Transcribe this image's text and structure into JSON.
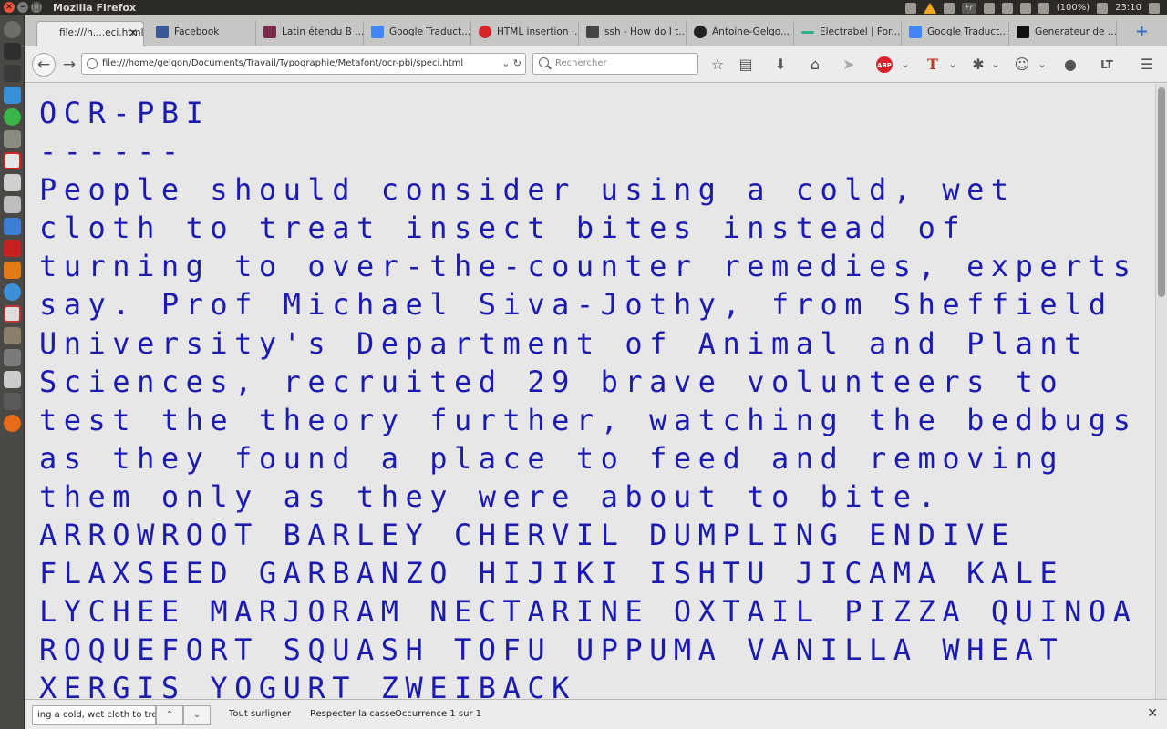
{
  "system": {
    "app_title": "Mozilla Firefox",
    "battery": "(100%)",
    "time": "23:10",
    "keyboard_layout": "Fr"
  },
  "tabs": [
    {
      "label": "file:///h....eci.html",
      "active": true,
      "icon": "file-icon"
    },
    {
      "label": "Facebook",
      "icon": "facebook-icon"
    },
    {
      "label": "Latin étendu B ...",
      "icon": "unicode-icon"
    },
    {
      "label": "Google Traduct...",
      "icon": "google-translate-icon"
    },
    {
      "label": "HTML insertion ...",
      "icon": "quora-icon"
    },
    {
      "label": "ssh - How do I t...",
      "icon": "stack-icon"
    },
    {
      "label": "Antoine-Gelgo...",
      "icon": "github-icon"
    },
    {
      "label": "Electrabel | For...",
      "icon": "electrabel-icon"
    },
    {
      "label": "Google Traduct...",
      "icon": "google-translate-icon"
    },
    {
      "label": "Generateur de ...",
      "icon": "dj-icon"
    }
  ],
  "navbar": {
    "url": "file:///home/gelgon/Documents/Travail/Typographie/Metafont/ocr-pbi/speci.html",
    "search_placeholder": "Rechercher"
  },
  "document": {
    "heading": "OCR-PBI",
    "rule": "------",
    "body": "People should consider using a cold, wet cloth to treat insect bites instead of turning to over-the-counter remedies, experts say. Prof Michael Siva-Jothy, from Sheffield University's Department of Animal and Plant Sciences, recruited 29 brave volunteers to test the theory further, watching the bedbugs as they found a place to feed and removing them only as they were about to bite.",
    "uppercase": "ARROWROOT BARLEY CHERVIL DUMPLING ENDIVE FLAXSEED GARBANZO HIJIKI ISHTU JICAMA KALE LYCHEE MARJORAM NECTARINE OXTAIL PIZZA QUINOA ROQUEFORT SQUASH TOFU UPPUMA VANILLA WHEAT XERGIS YOGURT ZWEIBACK",
    "text_color": "#1b1bb0"
  },
  "findbar": {
    "query": "ing a cold, wet cloth to treat",
    "highlight_all": "Tout surligner",
    "match_case": "Respecter la casse",
    "status": "Occurrence 1 sur 1"
  }
}
